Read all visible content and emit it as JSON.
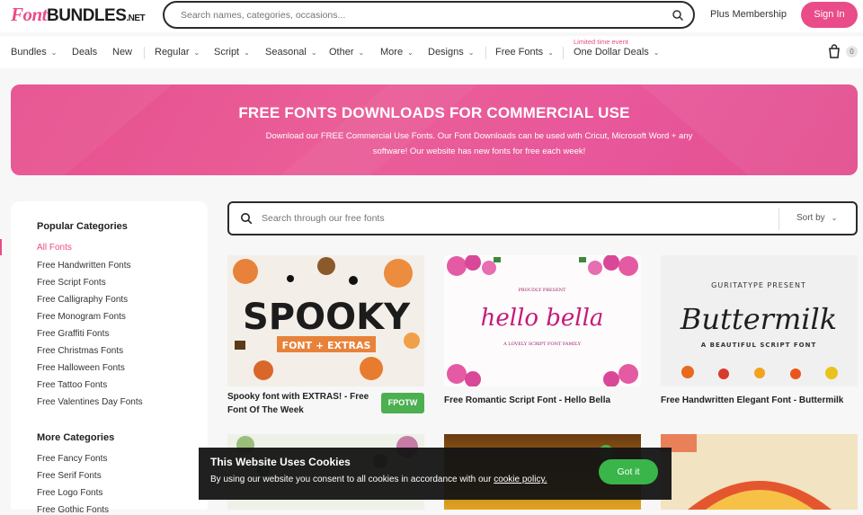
{
  "header": {
    "logo": {
      "part1": "Font",
      "part2": "BUNDLES",
      "part3": ".NET"
    },
    "search_placeholder": "Search names, categories, occasions...",
    "plus_membership": "Plus Membership",
    "sign_in": "Sign In",
    "cart_count": "0"
  },
  "nav": {
    "items": [
      "Bundles",
      "Deals",
      "New",
      "Regular",
      "Script",
      "Seasonal",
      "Other",
      "More",
      "Designs",
      "Free Fonts",
      "One Dollar Deals"
    ],
    "limited_label": "Limited time event"
  },
  "hero": {
    "title": "FREE FONTS DOWNLOADS FOR COMMERCIAL USE",
    "subtitle_line1": "Download our FREE Commercial Use Fonts. Our Font Downloads can be used with Cricut, Microsoft Word + any",
    "subtitle_line2": "software! Our website has new fonts for free each week!"
  },
  "sidebar": {
    "popular_heading": "Popular Categories",
    "popular": [
      "All Fonts",
      "Free Handwritten Fonts",
      "Free Script Fonts",
      "Free Calligraphy Fonts",
      "Free Monogram Fonts",
      "Free Graffiti Fonts",
      "Free Christmas Fonts",
      "Free Halloween Fonts",
      "Free Tattoo Fonts",
      "Free Valentines Day Fonts"
    ],
    "more_heading": "More Categories",
    "more": [
      "Free Fancy Fonts",
      "Free Serif Fonts",
      "Free Logo Fonts",
      "Free Gothic Fonts"
    ]
  },
  "font_search": {
    "placeholder": "Search through our free fonts",
    "sort_label": "Sort by"
  },
  "cards": [
    {
      "title_line1": "Spooky font with EXTRAS! - Free",
      "title_line2": "Font Of The Week",
      "badge": "FPOTW",
      "art_text": "SPOOKY",
      "art_sub": "FONT + EXTRAS"
    },
    {
      "title_line1": "Free Romantic Script Font - Hello Bella",
      "art_text": "hello bella",
      "art_top": "PROUDLY PRESENT",
      "art_sub": "A LOVELY SCRIPT FONT FAMILY"
    },
    {
      "title_line1": "Free Handwritten Elegant Font - Buttermilk",
      "art_text": "Buttermilk",
      "art_top": "GURITATYPE PRESENT",
      "art_sub": "A BEAUTIFUL SCRIPT FONT"
    }
  ],
  "cookie": {
    "title": "This Website Uses Cookies",
    "text": "By using our website you consent to all cookies in accordance with our",
    "link": "cookie policy.",
    "button": "Got it"
  },
  "colors": {
    "brand": "#e94c89",
    "badge": "#4caf50",
    "gotit": "#39b54a"
  }
}
